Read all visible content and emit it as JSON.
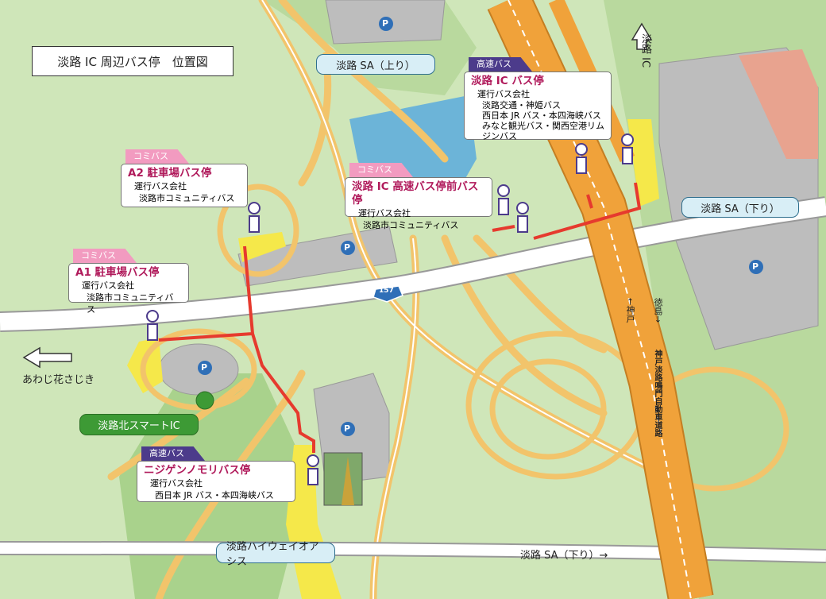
{
  "title": "淡路 IC 周辺バス停　位置図",
  "places": {
    "awaji_sa_up": "淡路 SA（上り）",
    "awaji_sa_down": "淡路 SA（下り）",
    "smart_ic": "淡路北スマートIC",
    "highway_oasis": "淡路ハイウェイオアシス",
    "awaji_ic": "淡路 IC",
    "awaji_hanasajiki": "あわじ花さじき",
    "route_157": "157",
    "sa_down_road": "淡路 SA（下り）→",
    "kobe_dir": "←神戸",
    "tokushima_dir": "徳島→",
    "expressway": "神戸淡路鳴門自動車道路",
    "parking": "P"
  },
  "stops": {
    "a2": {
      "tag": "コミバス",
      "name": "A2 駐車場バス停",
      "operator_label": "運行バス会社",
      "companies": [
        "淡路市コミュニティバス"
      ]
    },
    "a1": {
      "tag": "コミバス",
      "name": "A1 駐車場バス停",
      "operator_label": "運行バス会社",
      "companies": [
        "淡路市コミュニティバス"
      ]
    },
    "ic_front": {
      "tag": "コミバス",
      "name": "淡路 IC 高速バス停前バス停",
      "operator_label": "運行バス会社",
      "companies": [
        "淡路市コミュニティバス"
      ]
    },
    "ic": {
      "tag": "高速バス",
      "name": "淡路 IC バス停",
      "operator_label": "運行バス会社",
      "companies": [
        "淡路交通・神姫バス",
        "西日本 JR バス・本四海峡バス",
        "みなと観光バス・関西空港リム",
        "ジンバス"
      ]
    },
    "nijigen": {
      "tag": "高速バス",
      "name": "ニジゲンノモリバス停",
      "operator_label": "運行バス会社",
      "companies": [
        "西日本 JR バス・本四海峡バス"
      ]
    }
  },
  "colors": {
    "background": "#cfe6b9",
    "road": "#f2c46b",
    "expressway": "#f0a23a",
    "route_line": "#e63a2e",
    "stop_title": "#b01a5b",
    "community_tag": "#f29bc0",
    "highway_tag": "#4c3b8b",
    "water": "#6cb4d8"
  }
}
